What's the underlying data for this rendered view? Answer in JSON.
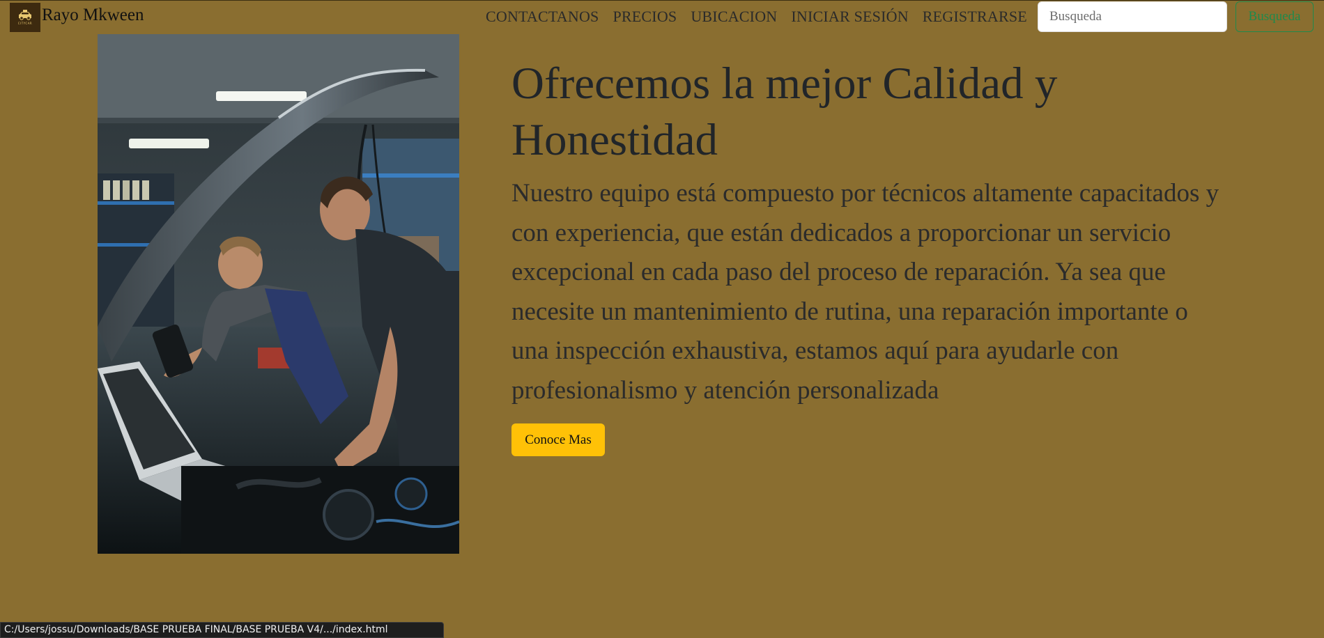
{
  "brand": {
    "name": "Rayo Mkween",
    "logo_icon": "car-icon",
    "logo_tiny_text": "CITYCAR"
  },
  "nav": {
    "links": [
      "CONTACTANOS",
      "PRECIOS",
      "UBICACION",
      "INICIAR SESIÓN",
      "REGISTRARSE"
    ]
  },
  "search": {
    "placeholder": "Busqueda",
    "value": "",
    "button_label": "Busqueda"
  },
  "hero": {
    "image_alt": "mechanics-working-under-car-hood",
    "title": "Ofrecemos la mejor Calidad y Honestidad",
    "text": "Nuestro equipo está compuesto por técnicos altamente capacitados y con experiencia, que están dedicados a proporcionar un servicio excepcional en cada paso del proceso de reparación. Ya sea que necesite un mantenimiento de rutina, una reparación importante o una inspección exhaustiva, estamos aquí para ayudarle con profesionalismo y atención personalizada",
    "cta_label": "Conoce Mas"
  },
  "status_bar": {
    "url": "C:/Users/jossu/Downloads/BASE PRUEBA FINAL/BASE PRUEBA V4/.../index.html"
  },
  "colors": {
    "background": "#8a6e30",
    "cta": "#ffc107",
    "search_button": "#1f8a4c",
    "logo_bg": "#3d2a0f"
  }
}
